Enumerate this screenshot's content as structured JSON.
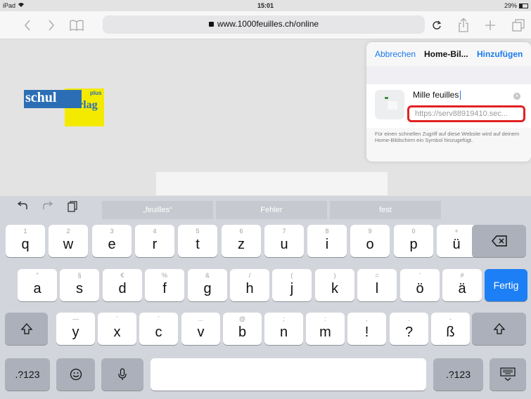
{
  "status_bar": {
    "device": "iPad",
    "time": "15:01",
    "battery": "29%"
  },
  "toolbar": {
    "back_icon": "chevron-left",
    "forward_icon": "chevron-right",
    "bookmarks_icon": "book",
    "url": "www.1000feuilles.ch/online",
    "reload_icon": "reload",
    "share_icon": "share",
    "add_tab_icon": "plus",
    "tabs_icon": "tabs"
  },
  "page": {
    "logo_schul": "schul",
    "logo_verlag": "verlag",
    "logo_plus": "plus"
  },
  "popover": {
    "cancel": "Abbrechen",
    "title": "Home-Bil...",
    "add": "Hinzufügen",
    "name_value": "Mille feuilles",
    "url_value": "https://serv88919410.sec...",
    "footer": "Für einen schnellen Zugriff auf diese Website wird auf deinem Home-Bildschirm ein Symbol hinzugefügt."
  },
  "keyboard": {
    "suggestions": [
      "„feuilles“",
      "Fehler",
      "fest"
    ],
    "row1": [
      {
        "main": "q",
        "sec": "1"
      },
      {
        "main": "w",
        "sec": "2"
      },
      {
        "main": "e",
        "sec": "3"
      },
      {
        "main": "r",
        "sec": "4"
      },
      {
        "main": "t",
        "sec": "5"
      },
      {
        "main": "z",
        "sec": "6"
      },
      {
        "main": "u",
        "sec": "7"
      },
      {
        "main": "i",
        "sec": "8"
      },
      {
        "main": "o",
        "sec": "9"
      },
      {
        "main": "p",
        "sec": "0"
      },
      {
        "main": "ü",
        "sec": "+"
      }
    ],
    "row2": [
      {
        "main": "a",
        "sec": "\""
      },
      {
        "main": "s",
        "sec": "§"
      },
      {
        "main": "d",
        "sec": "€"
      },
      {
        "main": "f",
        "sec": "%"
      },
      {
        "main": "g",
        "sec": "&"
      },
      {
        "main": "h",
        "sec": "/"
      },
      {
        "main": "j",
        "sec": "("
      },
      {
        "main": "k",
        "sec": ")"
      },
      {
        "main": "l",
        "sec": "="
      },
      {
        "main": "ö",
        "sec": "'"
      },
      {
        "main": "ä",
        "sec": "#"
      }
    ],
    "row3": [
      {
        "main": "y",
        "sec": "—"
      },
      {
        "main": "x",
        "sec": "`"
      },
      {
        "main": "c",
        "sec": "´"
      },
      {
        "main": "v",
        "sec": "..."
      },
      {
        "main": "b",
        "sec": "@"
      },
      {
        "main": "n",
        "sec": ";"
      },
      {
        "main": "m",
        "sec": ":"
      },
      {
        "main": "!",
        "sec": ","
      },
      {
        "main": "?",
        "sec": "."
      },
      {
        "main": "ß",
        "sec": "-"
      }
    ],
    "fertig": "Fertig",
    "numbers_left": ".?123",
    "numbers_right": ".?123"
  }
}
